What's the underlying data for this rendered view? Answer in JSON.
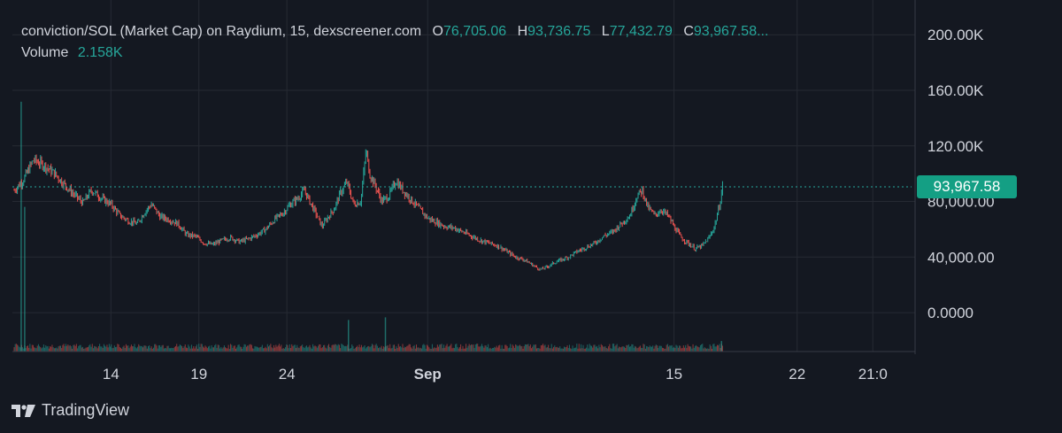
{
  "legend": {
    "title": "conviction/SOL (Market Cap) on Raydium, 15, dexscreener.com",
    "o_label": "O",
    "o_value": "76,705.06",
    "h_label": "H",
    "h_value": "93,736.75",
    "l_label": "L",
    "l_value": "77,432.79",
    "c_label": "C",
    "c_value": "93,967.58...",
    "volume_label": "Volume",
    "volume_value": "2.158K"
  },
  "last_price_tag": "93,967.58",
  "brand": {
    "name": "TradingView",
    "icon": "tradingview-logo-icon"
  },
  "colors": {
    "up": "#26a69a",
    "down": "#ef5350",
    "background": "#141821",
    "grid": "#262a33",
    "tag": "#149f84"
  },
  "chart_data": {
    "type": "candlestick",
    "title": "conviction/SOL (Market Cap) on Raydium, 15",
    "y_ticks": [
      "200.00K",
      "160.00K",
      "120.00K",
      "80,000.00",
      "40,000.00",
      "0.0000"
    ],
    "y_tick_values": [
      200000,
      160000,
      120000,
      80000,
      40000,
      0
    ],
    "ylim": [
      -28000,
      225000
    ],
    "x_ticks": [
      {
        "label": "14",
        "day": 14
      },
      {
        "label": "19",
        "day": 19
      },
      {
        "label": "24",
        "day": 24
      },
      {
        "label": "Sep",
        "day": 32,
        "bold": true
      },
      {
        "label": "15",
        "day": 46
      },
      {
        "label": "22",
        "day": 53
      },
      {
        "label": "21:0",
        "day": 57.3
      }
    ],
    "xlim": [
      8.4,
      59.5
    ],
    "last_price": 93967.58,
    "grid": true,
    "series": [
      {
        "name": "Market Cap",
        "points": [
          [
            8.5,
            88000
          ],
          [
            9.0,
            95000
          ],
          [
            9.6,
            110000
          ],
          [
            10.2,
            106000
          ],
          [
            10.8,
            100000
          ],
          [
            11.3,
            93000
          ],
          [
            11.9,
            85000
          ],
          [
            12.4,
            79000
          ],
          [
            12.9,
            88000
          ],
          [
            13.5,
            82000
          ],
          [
            14.0,
            78000
          ],
          [
            14.5,
            70000
          ],
          [
            15.0,
            66000
          ],
          [
            15.5,
            64000
          ],
          [
            15.9,
            72000
          ],
          [
            16.3,
            78000
          ],
          [
            16.8,
            69000
          ],
          [
            17.3,
            67000
          ],
          [
            17.8,
            64000
          ],
          [
            18.3,
            56000
          ],
          [
            18.8,
            55000
          ],
          [
            19.3,
            50000
          ],
          [
            19.8,
            49000
          ],
          [
            20.3,
            52000
          ],
          [
            20.8,
            54000
          ],
          [
            21.3,
            51000
          ],
          [
            21.8,
            53000
          ],
          [
            22.3,
            56000
          ],
          [
            22.8,
            60000
          ],
          [
            23.3,
            67000
          ],
          [
            23.8,
            72000
          ],
          [
            24.2,
            78000
          ],
          [
            24.6,
            82000
          ],
          [
            25.0,
            88000
          ],
          [
            25.3,
            80000
          ],
          [
            25.7,
            70000
          ],
          [
            26.0,
            62000
          ],
          [
            26.3,
            68000
          ],
          [
            26.7,
            75000
          ],
          [
            27.0,
            85000
          ],
          [
            27.4,
            94000
          ],
          [
            27.8,
            78000
          ],
          [
            28.2,
            80000
          ],
          [
            28.5,
            117000
          ],
          [
            28.7,
            100000
          ],
          [
            29.0,
            92000
          ],
          [
            29.4,
            80000
          ],
          [
            29.8,
            84000
          ],
          [
            30.2,
            95000
          ],
          [
            30.6,
            88000
          ],
          [
            31.0,
            82000
          ],
          [
            31.5,
            75000
          ],
          [
            32.0,
            68000
          ],
          [
            32.5,
            65000
          ],
          [
            33.0,
            62000
          ],
          [
            33.5,
            61000
          ],
          [
            34.0,
            58000
          ],
          [
            34.5,
            55000
          ],
          [
            35.0,
            52000
          ],
          [
            35.5,
            50000
          ],
          [
            36.0,
            48000
          ],
          [
            36.5,
            44000
          ],
          [
            37.0,
            40000
          ],
          [
            37.5,
            38000
          ],
          [
            38.0,
            34000
          ],
          [
            38.4,
            31000
          ],
          [
            38.8,
            33000
          ],
          [
            39.2,
            36000
          ],
          [
            39.6,
            38000
          ],
          [
            40.0,
            40000
          ],
          [
            40.5,
            44000
          ],
          [
            41.0,
            47000
          ],
          [
            41.5,
            50000
          ],
          [
            42.0,
            55000
          ],
          [
            42.5,
            58000
          ],
          [
            43.0,
            64000
          ],
          [
            43.5,
            70000
          ],
          [
            43.9,
            84000
          ],
          [
            44.2,
            88000
          ],
          [
            44.5,
            76000
          ],
          [
            44.9,
            70000
          ],
          [
            45.3,
            74000
          ],
          [
            45.7,
            69000
          ],
          [
            46.0,
            62000
          ],
          [
            46.4,
            54000
          ],
          [
            46.8,
            50000
          ],
          [
            47.2,
            46000
          ],
          [
            47.6,
            48000
          ],
          [
            48.0,
            54000
          ],
          [
            48.3,
            62000
          ],
          [
            48.6,
            78000
          ],
          [
            48.8,
            93967
          ]
        ]
      },
      {
        "name": "Volume",
        "spikes": [
          {
            "day": 8.9,
            "value": 0.95
          },
          {
            "day": 9.1,
            "value": 0.55
          },
          {
            "day": 27.5,
            "value": 0.12
          },
          {
            "day": 29.6,
            "value": 0.13
          },
          {
            "day": 48.7,
            "value": 0.04
          }
        ],
        "baseline": 0.02
      }
    ]
  }
}
